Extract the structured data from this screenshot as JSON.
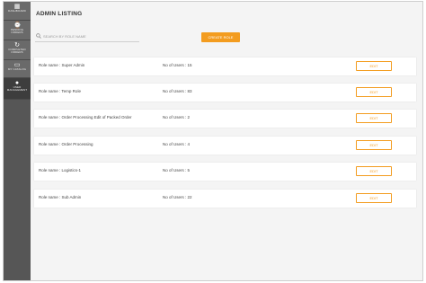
{
  "sidebar": {
    "items": [
      {
        "icon": "dashboard-grid-icon",
        "glyph": "▦",
        "label": "DASHBOARD"
      },
      {
        "icon": "pending-orders-icon",
        "glyph": "⌚",
        "label": "PENDING ORDERS"
      },
      {
        "icon": "completed-orders-icon",
        "glyph": "↻",
        "label": "COMPLETED ORDERS"
      },
      {
        "icon": "catalog-icon",
        "glyph": "▭",
        "label": "MY CATALOG"
      },
      {
        "icon": "user-icon",
        "glyph": "●",
        "label": "USER MANAGEMENT"
      }
    ]
  },
  "header": {
    "title": "ADMIN LISTING"
  },
  "search": {
    "placeholder": "SEARCH BY ROLE NAME",
    "icon": "search-icon"
  },
  "actions": {
    "create_label": "CREATE ROLE"
  },
  "roles": [
    {
      "name": "Role name : Super Admin",
      "users": "No of Users : 15",
      "edit": "EDIT"
    },
    {
      "name": "Role name : Temp Role",
      "users": "No of Users : 83",
      "edit": "EDIT"
    },
    {
      "name": "Role name : Order Processing Edit of Packed Order",
      "users": "No of Users : 2",
      "edit": "EDIT"
    },
    {
      "name": "Role name : Order Processing",
      "users": "No of Users : 4",
      "edit": "EDIT"
    },
    {
      "name": "Role name : Logistics-1",
      "users": "No of Users : 5",
      "edit": "EDIT"
    },
    {
      "name": "Role name : Sub Admin",
      "users": "No of Users : 22",
      "edit": "EDIT"
    }
  ],
  "colors": {
    "accent": "#f39c1f",
    "sidebar": "#565656",
    "sidebar_active": "#3d3d3d",
    "background": "#f4f4f4"
  }
}
